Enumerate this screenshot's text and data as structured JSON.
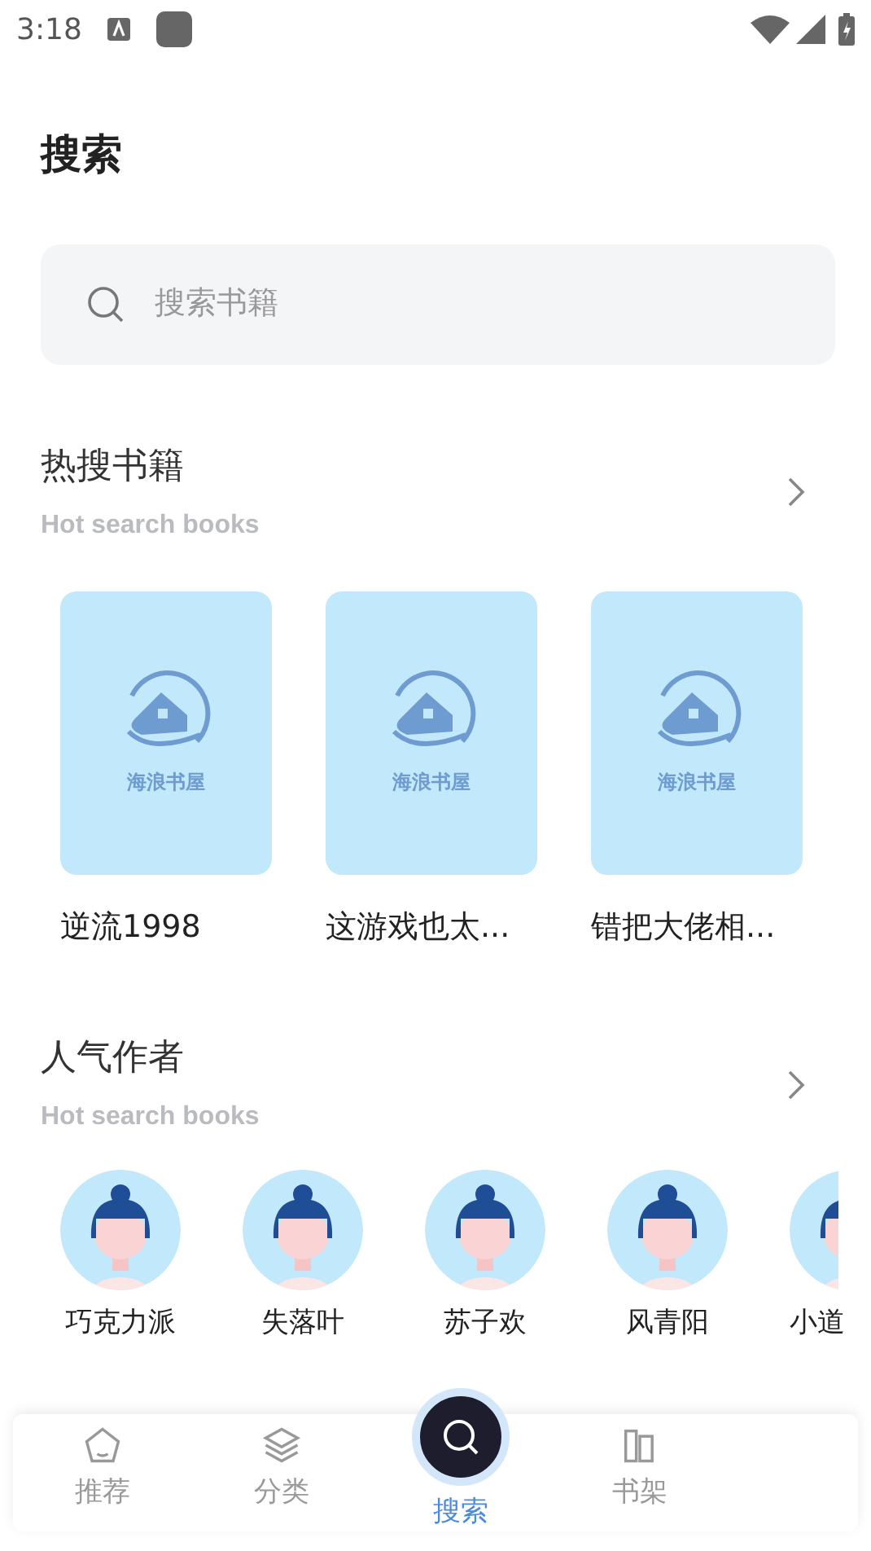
{
  "status_bar": {
    "time": "3:18"
  },
  "title": "搜索",
  "search": {
    "placeholder": "搜索书籍"
  },
  "hot_books": {
    "title": "热搜书籍",
    "subtitle": "Hot search books",
    "books": [
      {
        "title": "逆流1998",
        "cover_text": "海浪书屋"
      },
      {
        "title": "这游戏也太...",
        "cover_text": "海浪书屋"
      },
      {
        "title": "错把大佬相...",
        "cover_text": "海浪书屋"
      }
    ]
  },
  "authors": {
    "title": "人气作者",
    "subtitle": "Hot search books",
    "items": [
      {
        "name": "巧克力派"
      },
      {
        "name": "失落叶"
      },
      {
        "name": "苏子欢"
      },
      {
        "name": "风青阳"
      },
      {
        "name": "小道"
      }
    ]
  },
  "tabs": [
    {
      "label": "推荐",
      "kind": "home",
      "selected": false
    },
    {
      "label": "分类",
      "kind": "layers",
      "selected": false
    },
    {
      "label": "搜索",
      "kind": "search",
      "selected": true
    },
    {
      "label": "书架",
      "kind": "shelf",
      "selected": false
    }
  ]
}
